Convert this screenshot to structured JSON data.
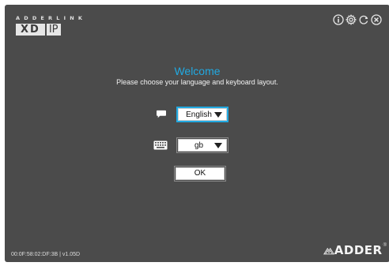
{
  "brand": {
    "line": "ADDERLINK",
    "logo_left": "XD",
    "logo_right": "IP"
  },
  "top_icons": [
    "info-icon",
    "gear-icon",
    "refresh-icon",
    "close-circle-icon"
  ],
  "welcome": {
    "title": "Welcome",
    "subtitle": "Please choose your language and keyboard layout."
  },
  "language": {
    "icon": "speech-bubble-icon",
    "selected": "English"
  },
  "keyboard": {
    "icon": "keyboard-icon",
    "selected": "gb"
  },
  "ok_label": "OK",
  "footer": {
    "mac_version": "00:0F:58:02:DF:3B | v1.05D",
    "logo_word": "ADDER",
    "logo_reg": "®"
  },
  "colors": {
    "background": "#4b4b4b",
    "accent": "#21a9e1",
    "text": "#f2f2f2"
  }
}
